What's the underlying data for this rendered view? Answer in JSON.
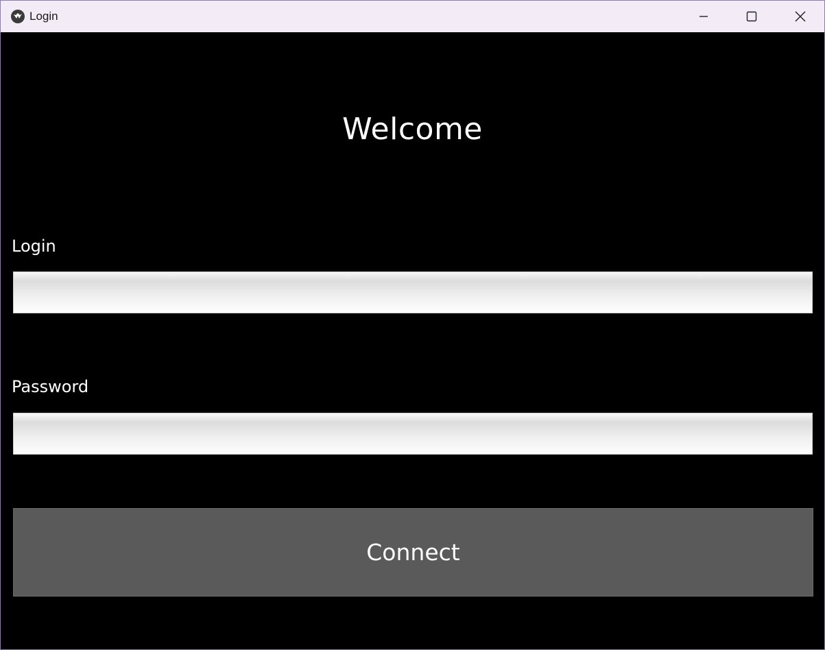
{
  "window": {
    "title": "Login",
    "app_icon": "kivy-logo-icon",
    "controls": {
      "minimize_icon": "minimize-icon",
      "maximize_icon": "maximize-icon",
      "close_icon": "close-icon"
    }
  },
  "form": {
    "heading": "Welcome",
    "login_label": "Login",
    "login_value": "",
    "password_label": "Password",
    "password_value": "",
    "submit_label": "Connect"
  },
  "colors": {
    "background": "#000000",
    "titlebar": "#f3ecf6",
    "button": "#5a5a5a",
    "text": "#ffffff"
  }
}
